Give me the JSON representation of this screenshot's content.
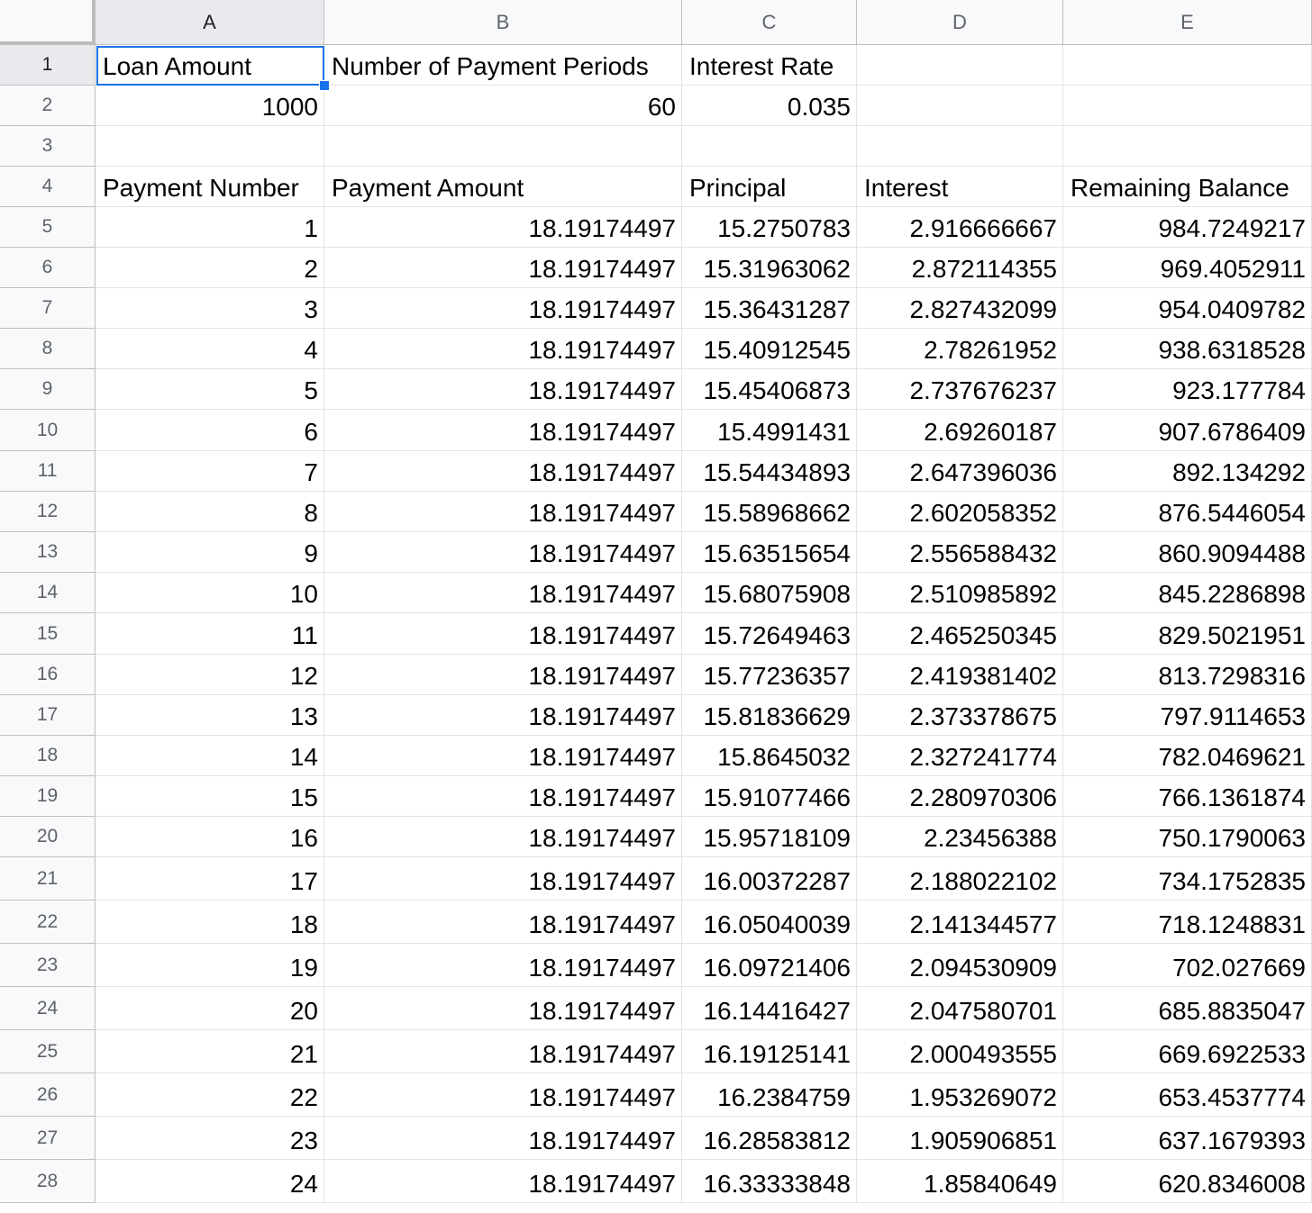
{
  "sheet": {
    "columns": [
      "A",
      "B",
      "C",
      "D",
      "E"
    ],
    "active_cell": "A1",
    "selection_color": "#1a73e8",
    "rows": [
      {
        "n": "1",
        "cells": [
          {
            "v": "Loan Amount",
            "t": "txt"
          },
          {
            "v": "Number of Payment Periods",
            "t": "txt"
          },
          {
            "v": "Interest Rate",
            "t": "txt"
          },
          {
            "v": "",
            "t": "txt"
          },
          {
            "v": "",
            "t": "txt"
          }
        ]
      },
      {
        "n": "2",
        "cells": [
          {
            "v": "1000",
            "t": "num"
          },
          {
            "v": "60",
            "t": "num"
          },
          {
            "v": "0.035",
            "t": "num"
          },
          {
            "v": "",
            "t": "txt"
          },
          {
            "v": "",
            "t": "txt"
          }
        ]
      },
      {
        "n": "3",
        "cells": [
          {
            "v": "",
            "t": "txt"
          },
          {
            "v": "",
            "t": "txt"
          },
          {
            "v": "",
            "t": "txt"
          },
          {
            "v": "",
            "t": "txt"
          },
          {
            "v": "",
            "t": "txt"
          }
        ]
      },
      {
        "n": "4",
        "cells": [
          {
            "v": "Payment Number",
            "t": "txt"
          },
          {
            "v": "Payment Amount",
            "t": "txt"
          },
          {
            "v": "Principal",
            "t": "txt"
          },
          {
            "v": "Interest",
            "t": "txt"
          },
          {
            "v": "Remaining Balance",
            "t": "txt"
          }
        ]
      },
      {
        "n": "5",
        "cells": [
          {
            "v": "1",
            "t": "num"
          },
          {
            "v": "18.19174497",
            "t": "num"
          },
          {
            "v": "15.2750783",
            "t": "num"
          },
          {
            "v": "2.916666667",
            "t": "num"
          },
          {
            "v": "984.7249217",
            "t": "num"
          }
        ]
      },
      {
        "n": "6",
        "cells": [
          {
            "v": "2",
            "t": "num"
          },
          {
            "v": "18.19174497",
            "t": "num"
          },
          {
            "v": "15.31963062",
            "t": "num"
          },
          {
            "v": "2.872114355",
            "t": "num"
          },
          {
            "v": "969.4052911",
            "t": "num"
          }
        ]
      },
      {
        "n": "7",
        "cells": [
          {
            "v": "3",
            "t": "num"
          },
          {
            "v": "18.19174497",
            "t": "num"
          },
          {
            "v": "15.36431287",
            "t": "num"
          },
          {
            "v": "2.827432099",
            "t": "num"
          },
          {
            "v": "954.0409782",
            "t": "num"
          }
        ]
      },
      {
        "n": "8",
        "cells": [
          {
            "v": "4",
            "t": "num"
          },
          {
            "v": "18.19174497",
            "t": "num"
          },
          {
            "v": "15.40912545",
            "t": "num"
          },
          {
            "v": "2.78261952",
            "t": "num"
          },
          {
            "v": "938.6318528",
            "t": "num"
          }
        ]
      },
      {
        "n": "9",
        "cells": [
          {
            "v": "5",
            "t": "num"
          },
          {
            "v": "18.19174497",
            "t": "num"
          },
          {
            "v": "15.45406873",
            "t": "num"
          },
          {
            "v": "2.737676237",
            "t": "num"
          },
          {
            "v": "923.177784",
            "t": "num"
          }
        ]
      },
      {
        "n": "10",
        "cells": [
          {
            "v": "6",
            "t": "num"
          },
          {
            "v": "18.19174497",
            "t": "num"
          },
          {
            "v": "15.4991431",
            "t": "num"
          },
          {
            "v": "2.69260187",
            "t": "num"
          },
          {
            "v": "907.6786409",
            "t": "num"
          }
        ]
      },
      {
        "n": "11",
        "cells": [
          {
            "v": "7",
            "t": "num"
          },
          {
            "v": "18.19174497",
            "t": "num"
          },
          {
            "v": "15.54434893",
            "t": "num"
          },
          {
            "v": "2.647396036",
            "t": "num"
          },
          {
            "v": "892.134292",
            "t": "num"
          }
        ]
      },
      {
        "n": "12",
        "cells": [
          {
            "v": "8",
            "t": "num"
          },
          {
            "v": "18.19174497",
            "t": "num"
          },
          {
            "v": "15.58968662",
            "t": "num"
          },
          {
            "v": "2.602058352",
            "t": "num"
          },
          {
            "v": "876.5446054",
            "t": "num"
          }
        ]
      },
      {
        "n": "13",
        "cells": [
          {
            "v": "9",
            "t": "num"
          },
          {
            "v": "18.19174497",
            "t": "num"
          },
          {
            "v": "15.63515654",
            "t": "num"
          },
          {
            "v": "2.556588432",
            "t": "num"
          },
          {
            "v": "860.9094488",
            "t": "num"
          }
        ]
      },
      {
        "n": "14",
        "cells": [
          {
            "v": "10",
            "t": "num"
          },
          {
            "v": "18.19174497",
            "t": "num"
          },
          {
            "v": "15.68075908",
            "t": "num"
          },
          {
            "v": "2.510985892",
            "t": "num"
          },
          {
            "v": "845.2286898",
            "t": "num"
          }
        ]
      },
      {
        "n": "15",
        "cells": [
          {
            "v": "11",
            "t": "num"
          },
          {
            "v": "18.19174497",
            "t": "num"
          },
          {
            "v": "15.72649463",
            "t": "num"
          },
          {
            "v": "2.465250345",
            "t": "num"
          },
          {
            "v": "829.5021951",
            "t": "num"
          }
        ]
      },
      {
        "n": "16",
        "cells": [
          {
            "v": "12",
            "t": "num"
          },
          {
            "v": "18.19174497",
            "t": "num"
          },
          {
            "v": "15.77236357",
            "t": "num"
          },
          {
            "v": "2.419381402",
            "t": "num"
          },
          {
            "v": "813.7298316",
            "t": "num"
          }
        ]
      },
      {
        "n": "17",
        "cells": [
          {
            "v": "13",
            "t": "num"
          },
          {
            "v": "18.19174497",
            "t": "num"
          },
          {
            "v": "15.81836629",
            "t": "num"
          },
          {
            "v": "2.373378675",
            "t": "num"
          },
          {
            "v": "797.9114653",
            "t": "num"
          }
        ]
      },
      {
        "n": "18",
        "cells": [
          {
            "v": "14",
            "t": "num"
          },
          {
            "v": "18.19174497",
            "t": "num"
          },
          {
            "v": "15.8645032",
            "t": "num"
          },
          {
            "v": "2.327241774",
            "t": "num"
          },
          {
            "v": "782.0469621",
            "t": "num"
          }
        ]
      },
      {
        "n": "19",
        "cells": [
          {
            "v": "15",
            "t": "num"
          },
          {
            "v": "18.19174497",
            "t": "num"
          },
          {
            "v": "15.91077466",
            "t": "num"
          },
          {
            "v": "2.280970306",
            "t": "num"
          },
          {
            "v": "766.1361874",
            "t": "num"
          }
        ]
      },
      {
        "n": "20",
        "cells": [
          {
            "v": "16",
            "t": "num"
          },
          {
            "v": "18.19174497",
            "t": "num"
          },
          {
            "v": "15.95718109",
            "t": "num"
          },
          {
            "v": "2.23456388",
            "t": "num"
          },
          {
            "v": "750.1790063",
            "t": "num"
          }
        ]
      },
      {
        "n": "21",
        "cells": [
          {
            "v": "17",
            "t": "num"
          },
          {
            "v": "18.19174497",
            "t": "num"
          },
          {
            "v": "16.00372287",
            "t": "num"
          },
          {
            "v": "2.188022102",
            "t": "num"
          },
          {
            "v": "734.1752835",
            "t": "num"
          }
        ]
      },
      {
        "n": "22",
        "cells": [
          {
            "v": "18",
            "t": "num"
          },
          {
            "v": "18.19174497",
            "t": "num"
          },
          {
            "v": "16.05040039",
            "t": "num"
          },
          {
            "v": "2.141344577",
            "t": "num"
          },
          {
            "v": "718.1248831",
            "t": "num"
          }
        ]
      },
      {
        "n": "23",
        "cells": [
          {
            "v": "19",
            "t": "num"
          },
          {
            "v": "18.19174497",
            "t": "num"
          },
          {
            "v": "16.09721406",
            "t": "num"
          },
          {
            "v": "2.094530909",
            "t": "num"
          },
          {
            "v": "702.027669",
            "t": "num"
          }
        ]
      },
      {
        "n": "24",
        "cells": [
          {
            "v": "20",
            "t": "num"
          },
          {
            "v": "18.19174497",
            "t": "num"
          },
          {
            "v": "16.14416427",
            "t": "num"
          },
          {
            "v": "2.047580701",
            "t": "num"
          },
          {
            "v": "685.8835047",
            "t": "num"
          }
        ]
      },
      {
        "n": "25",
        "cells": [
          {
            "v": "21",
            "t": "num"
          },
          {
            "v": "18.19174497",
            "t": "num"
          },
          {
            "v": "16.19125141",
            "t": "num"
          },
          {
            "v": "2.000493555",
            "t": "num"
          },
          {
            "v": "669.6922533",
            "t": "num"
          }
        ]
      },
      {
        "n": "26",
        "cells": [
          {
            "v": "22",
            "t": "num"
          },
          {
            "v": "18.19174497",
            "t": "num"
          },
          {
            "v": "16.2384759",
            "t": "num"
          },
          {
            "v": "1.953269072",
            "t": "num"
          },
          {
            "v": "653.4537774",
            "t": "num"
          }
        ]
      },
      {
        "n": "27",
        "cells": [
          {
            "v": "23",
            "t": "num"
          },
          {
            "v": "18.19174497",
            "t": "num"
          },
          {
            "v": "16.28583812",
            "t": "num"
          },
          {
            "v": "1.905906851",
            "t": "num"
          },
          {
            "v": "637.1679393",
            "t": "num"
          }
        ]
      },
      {
        "n": "28",
        "cells": [
          {
            "v": "24",
            "t": "num"
          },
          {
            "v": "18.19174497",
            "t": "num"
          },
          {
            "v": "16.33333848",
            "t": "num"
          },
          {
            "v": "1.85840649",
            "t": "num"
          },
          {
            "v": "620.8346008",
            "t": "num"
          }
        ]
      }
    ]
  }
}
